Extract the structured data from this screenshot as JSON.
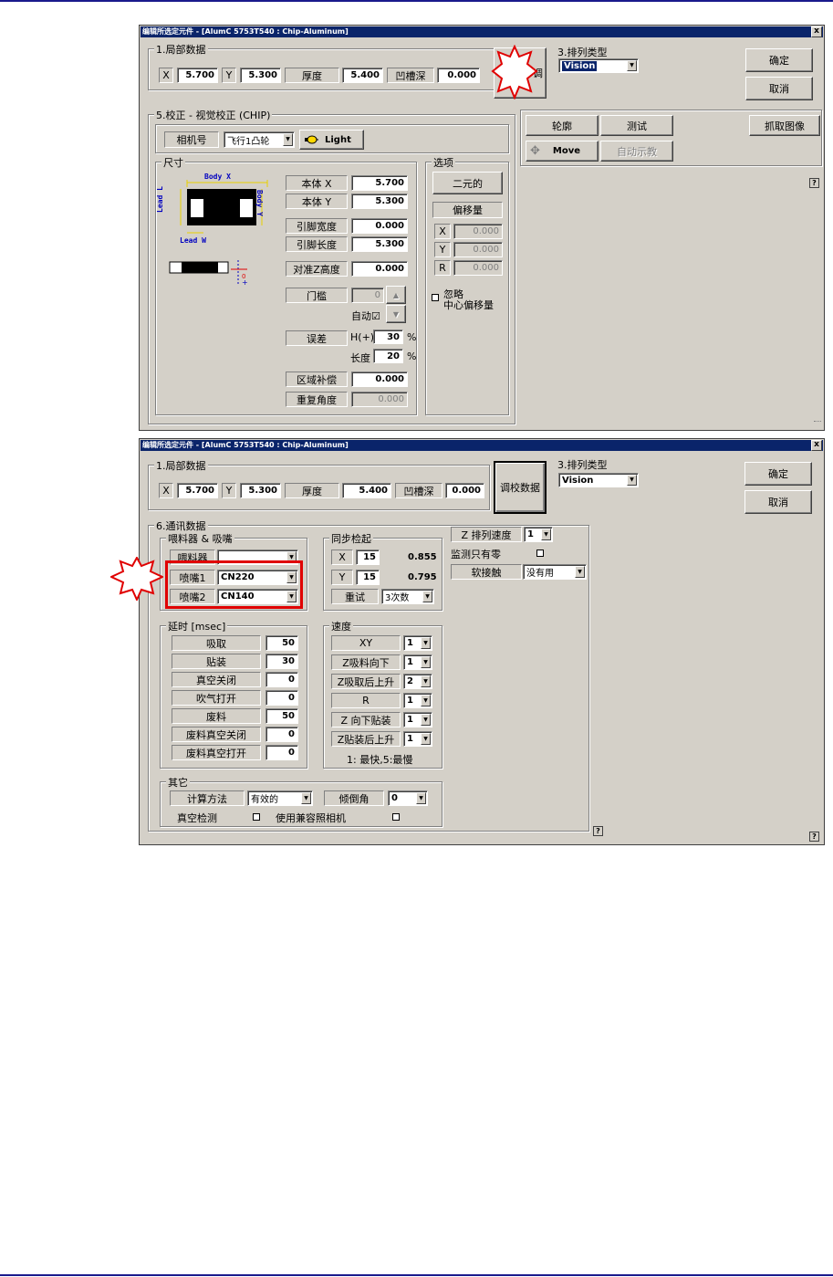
{
  "w1": {
    "title": "编辑所选定元件 - [AlumC 5753T540 : Chip-Aluminum]",
    "close": "x",
    "local_group": "1.局部数据",
    "x_label": "X",
    "x_value": "5.700",
    "y_label": "Y",
    "y_value": "5.300",
    "thickness_label": "厚度",
    "thickness_value": "5.400",
    "groove_label": "凹槽深",
    "groove_value": "0.000",
    "star_button_label": "调",
    "arrange_label": "3.排列类型",
    "arrange_value": "Vision",
    "ok": "确定",
    "cancel": "取消",
    "calib_group": "5.校正 - 视觉校正 (CHIP)",
    "camera_label": "相机号",
    "camera_value": "飞行1凸轮",
    "light_button": "Light",
    "outline_button": "轮廓",
    "test_button": "测试",
    "grab_button": "抓取图像",
    "move_button": "Move",
    "auto_teach_button": "自动示教",
    "size_group": "尺寸",
    "diagram": {
      "body_x": "Body X",
      "body_y": "Body Y",
      "lead_l": "Lead L",
      "lead_w": "Lead W",
      "zero": "0"
    },
    "body_x_label": "本体 X",
    "body_x_value": "5.700",
    "body_y_label": "本体 Y",
    "body_y_value": "5.300",
    "lead_width_label": "引脚宽度",
    "lead_width_value": "0.000",
    "lead_length_label": "引脚长度",
    "lead_length_value": "5.300",
    "align_z_label": "对准Z高度",
    "align_z_value": "0.000",
    "threshold_label": "门槛",
    "threshold_value": "0",
    "auto_label": "自动☑",
    "error_label": "误差",
    "h_label": "H(+)",
    "h_value": "30",
    "h_unit": "%",
    "len_label": "长度",
    "len_value": "20",
    "len_unit": "%",
    "area_comp_label": "区域补偿",
    "area_comp_value": "0.000",
    "repeat_angle_label": "重复角度",
    "repeat_angle_value": "0.000",
    "options_group": "选项",
    "binary_button": "二元的",
    "offset_button": "偏移量",
    "off_x_label": "X",
    "off_x_value": "0.000",
    "off_y_label": "Y",
    "off_y_value": "0.000",
    "off_r_label": "R",
    "off_r_value": "0.000",
    "ignore_line1": "忽略",
    "ignore_line2": "中心偏移量",
    "help": "?"
  },
  "w2": {
    "title": "编辑所选定元件 - [AlumC 5753T540 : Chip-Aluminum]",
    "close": "x",
    "local_group": "1.局部数据",
    "x_label": "X",
    "x_value": "5.700",
    "y_label": "Y",
    "y_value": "5.300",
    "thickness_label": "厚度",
    "thickness_value": "5.400",
    "groove_label": "凹槽深",
    "groove_value": "0.000",
    "calib_data_button": "调校数据",
    "arrange_label": "3.排列类型",
    "arrange_value": "Vision",
    "ok": "确定",
    "cancel": "取消",
    "comm_group": "6.通讯数据",
    "feeder_group": "喂料器 & 吸嘴",
    "feeder_label": "喂料器",
    "feeder_value": "",
    "nozzle1_label": "喷嘴1",
    "nozzle1_value": "CN220",
    "nozzle2_label": "喷嘴2",
    "nozzle2_value": "CN140",
    "sync_group": "同步检起",
    "sync_x_label": "X",
    "sync_x_value": "15",
    "sync_x_read": "0.855",
    "sync_y_label": "Y",
    "sync_y_value": "15",
    "sync_y_read": "0.795",
    "retry_label": "重试",
    "retry_value": "3次数",
    "z_speed_label": "Z 排列速度",
    "z_speed_value": "1",
    "monitor_label": "监测只有零",
    "soft_label": "软接触",
    "soft_value": "没有用",
    "delay_group": "延时 [msec]",
    "delays": [
      {
        "label": "吸取",
        "value": "50"
      },
      {
        "label": "贴装",
        "value": "30"
      },
      {
        "label": "真空关闭",
        "value": "0"
      },
      {
        "label": "吹气打开",
        "value": "0"
      },
      {
        "label": "废料",
        "value": "50"
      },
      {
        "label": "废料真空关闭",
        "value": "0"
      },
      {
        "label": "废料真空打开",
        "value": "0"
      }
    ],
    "speed_group": "速度",
    "speeds": [
      {
        "label": "XY",
        "value": "1"
      },
      {
        "label": "Z吸料向下",
        "value": "1"
      },
      {
        "label": "Z吸取后上升",
        "value": "2"
      },
      {
        "label": "R",
        "value": "1"
      },
      {
        "label": "Z 向下贴装",
        "value": "1"
      },
      {
        "label": "Z贴装后上升",
        "value": "1"
      }
    ],
    "speed_note": "1: 最快,5:最慢",
    "other_group": "其它",
    "calc_label": "计算方法",
    "calc_value": "有效的",
    "tilt_label": "倾倒角",
    "tilt_value": "0",
    "vacuum_check_label": "真空检测",
    "compat_camera_label": "使用兼容照相机",
    "help": "?"
  }
}
